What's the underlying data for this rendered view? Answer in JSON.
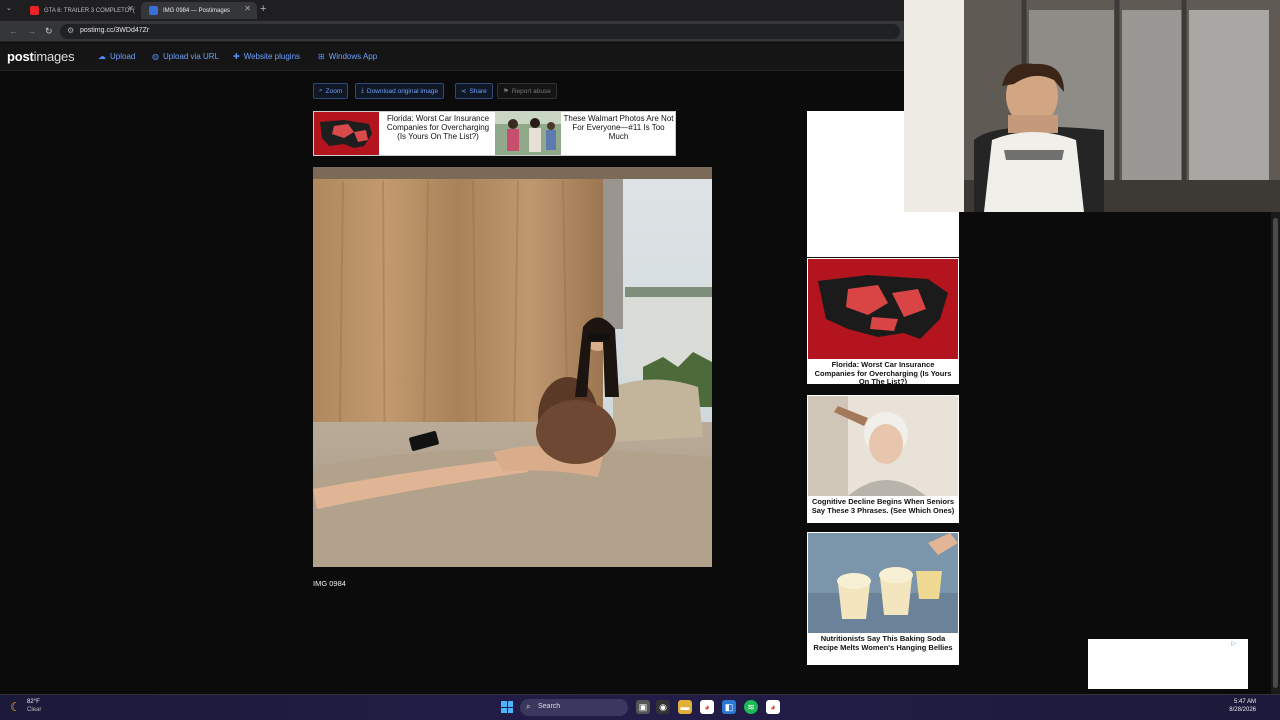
{
  "browser": {
    "tabs": [
      {
        "label": "GTA 6: TRAILER 3 COMPLETO! (",
        "favicon": "youtube-icon",
        "color": "#e22"
      },
      {
        "label": "IMG 0984 — Postimages",
        "favicon": "postimages-icon",
        "color": "#3b6fd8"
      }
    ],
    "new_tab": "+",
    "url": "postimg.cc/3WDd47Zr"
  },
  "site": {
    "logo_bold": "post",
    "logo_light": "images",
    "nav": [
      {
        "label": "Upload",
        "icon": "cloud-upload-icon"
      },
      {
        "label": "Upload via URL",
        "icon": "globe-icon"
      },
      {
        "label": "Website plugins",
        "icon": "puzzle-icon"
      },
      {
        "label": "Windows App",
        "icon": "windows-icon"
      }
    ]
  },
  "toolbar": {
    "zoom": "Zoom",
    "download": "Download original image",
    "share": "Share",
    "report": "Report abuse"
  },
  "top_ad": {
    "left_text": "Florida: Worst Car Insurance Companies for Overcharging (Is Yours On The List?)",
    "right_text": "These Walmart Photos Are Not For Everyone—#11 Is Too Much"
  },
  "image": {
    "caption": "IMG 0984"
  },
  "right_ads": [
    {
      "title": "Florida: Worst Car Insurance Companies for Overcharging (Is Yours On The List?)"
    },
    {
      "title": "Cognitive Decline Begins When Seniors Say These 3 Phrases. (See Which Ones)"
    },
    {
      "title": "Nutritionists Say This Baking Soda Recipe Melts Women's Hanging Bellies"
    }
  ],
  "taskbar": {
    "weather_temp": "82°F",
    "weather_desc": "Clear",
    "search_label": "Search",
    "time": "5:47 AM",
    "date": "8/28/2026"
  }
}
